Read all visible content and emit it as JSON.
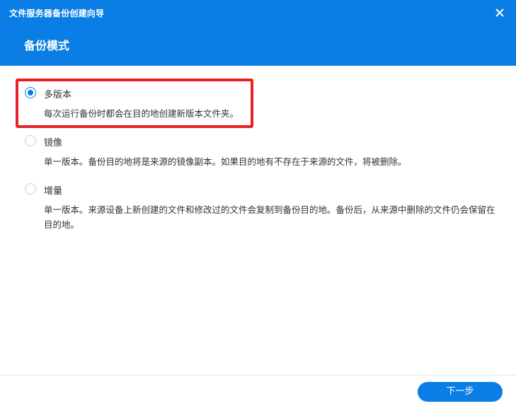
{
  "window": {
    "title": "文件服务器备份创建向导",
    "close_icon": "close-icon"
  },
  "header": {
    "step_title": "备份模式"
  },
  "options": [
    {
      "label": "多版本",
      "description": "每次运行备份时都会在目的地创建新版本文件夹。",
      "selected": true
    },
    {
      "label": "镜像",
      "description": "单一版本。备份目的地将是来源的镜像副本。如果目的地有不存在于来源的文件，将被删除。",
      "selected": false
    },
    {
      "label": "增量",
      "description": "单一版本。来源设备上新创建的文件和修改过的文件会复制到备份目的地。备份后，从来源中删除的文件仍会保留在目的地。",
      "selected": false
    }
  ],
  "footer": {
    "next_label": "下一步"
  },
  "colors": {
    "accent": "#0a7ee4",
    "highlight": "#e8202a"
  }
}
